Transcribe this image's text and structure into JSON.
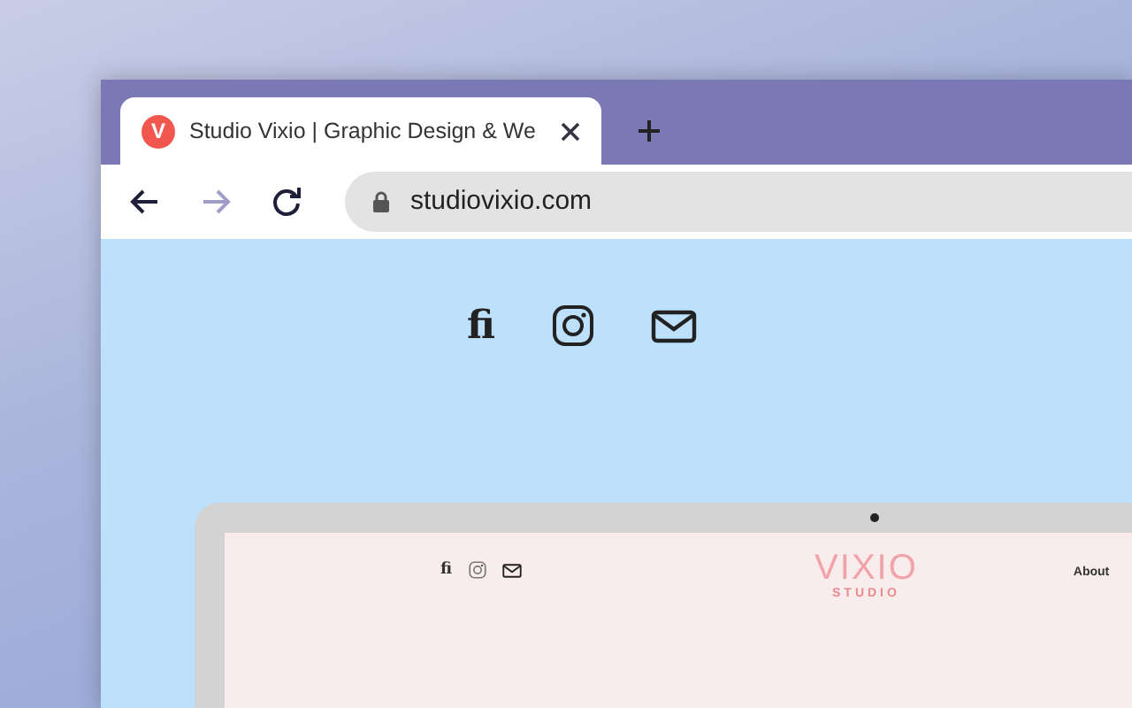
{
  "tab": {
    "title": "Studio Vixio | Graphic Design & We",
    "favicon_letter": "V",
    "selected": true
  },
  "nav_buttons": [
    {
      "kind": "back",
      "disabled": false
    },
    {
      "kind": "forward",
      "disabled": true
    },
    {
      "kind": "reload",
      "disabled": false
    }
  ],
  "address": "studiovixio.com",
  "social_links": [
    {
      "kind": "text",
      "label": "fi"
    },
    {
      "kind": "instagram"
    },
    {
      "kind": "mail"
    }
  ],
  "mockup": {
    "social_links": [
      {
        "kind": "text",
        "label": "fi"
      },
      {
        "kind": "instagram"
      },
      {
        "kind": "mail"
      }
    ],
    "logo": "VIXIO",
    "logo_sub": "STUDIO",
    "nav": [
      "About"
    ]
  }
}
